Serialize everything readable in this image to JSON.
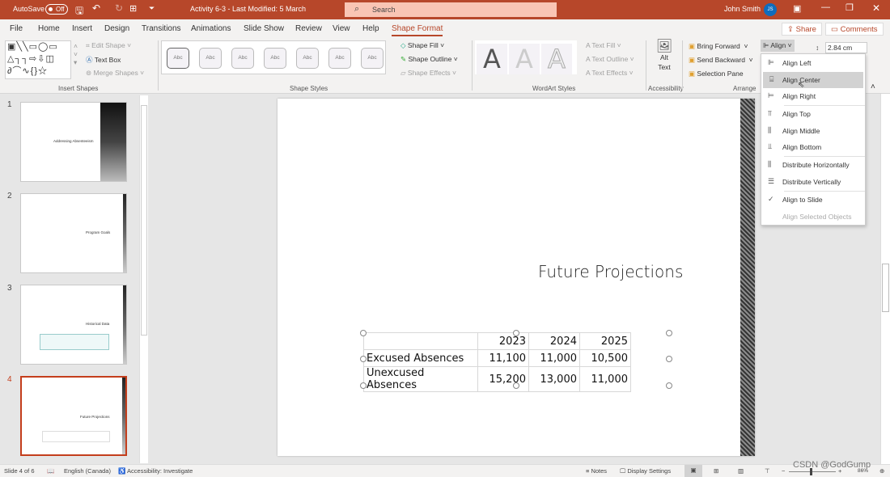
{
  "titlebar": {
    "autosave_label": "AutoSave",
    "autosave_state": "Off",
    "doc_title": "Activity 6-3  -  Last Modified: 5 March",
    "search_placeholder": "Search",
    "user_name": "John Smith",
    "user_initials": "JS"
  },
  "tabs": [
    {
      "label": "File"
    },
    {
      "label": "Home"
    },
    {
      "label": "Insert"
    },
    {
      "label": "Design"
    },
    {
      "label": "Transitions"
    },
    {
      "label": "Animations"
    },
    {
      "label": "Slide Show"
    },
    {
      "label": "Review"
    },
    {
      "label": "View"
    },
    {
      "label": "Help"
    },
    {
      "label": "Shape Format",
      "active": true
    }
  ],
  "share_label": "Share",
  "comments_label": "Comments",
  "ribbon": {
    "insert_shapes": {
      "label": "Insert Shapes",
      "edit_shape": "Edit Shape",
      "text_box": "Text Box",
      "merge_shapes": "Merge Shapes"
    },
    "shape_styles": {
      "label": "Shape Styles",
      "swatch": "Abc",
      "shape_fill": "Shape Fill",
      "shape_outline": "Shape Outline",
      "shape_effects": "Shape Effects"
    },
    "wordart": {
      "label": "WordArt Styles",
      "glyph": "A",
      "text_fill": "Text Fill",
      "text_outline": "Text Outline",
      "text_effects": "Text Effects"
    },
    "accessibility": {
      "label": "Accessibility",
      "alt_text": "Alt Text"
    },
    "arrange": {
      "label": "Arrange",
      "bring_forward": "Bring Forward",
      "send_backward": "Send Backward",
      "selection_pane": "Selection Pane",
      "align": "Align"
    },
    "size": {
      "height": "2.84 cm"
    }
  },
  "align_menu": [
    {
      "label": "Align Left",
      "icon": "align-left-icon"
    },
    {
      "label": "Align Center",
      "icon": "align-center-icon",
      "highlighted": true
    },
    {
      "label": "Align Right",
      "icon": "align-right-icon"
    },
    {
      "label": "Align Top",
      "icon": "align-top-icon"
    },
    {
      "label": "Align Middle",
      "icon": "align-middle-icon"
    },
    {
      "label": "Align Bottom",
      "icon": "align-bottom-icon"
    },
    {
      "label": "Distribute Horizontally",
      "icon": "distribute-horizontal-icon"
    },
    {
      "label": "Distribute Vertically",
      "icon": "distribute-vertical-icon"
    },
    {
      "label": "Align to Slide",
      "icon": "check-icon",
      "checked": true
    },
    {
      "label": "Align Selected Objects",
      "disabled": true
    }
  ],
  "thumbnails": [
    {
      "num": "1",
      "title": "Addressing Absenteeism"
    },
    {
      "num": "2",
      "title": "Program Goals"
    },
    {
      "num": "3",
      "title": "Historical Data"
    },
    {
      "num": "4",
      "title": "Future Projections",
      "selected": true
    }
  ],
  "slide": {
    "title": "Future Projections",
    "table": {
      "headers": [
        "",
        "2023",
        "2024",
        "2025"
      ],
      "rows": [
        [
          "Excused Absences",
          "11,100",
          "11,000",
          "10,500"
        ],
        [
          "Unexcused Absences",
          "15,200",
          "13,000",
          "11,000"
        ]
      ]
    }
  },
  "status": {
    "slide_info": "Slide 4 of 6",
    "language": "English (Canada)",
    "accessibility": "Accessibility: Investigate",
    "notes": "Notes",
    "display_settings": "Display Settings",
    "zoom": "86%"
  },
  "watermark": "CSDN @GodGump",
  "colors": {
    "accent": "#b7472a",
    "selected_thumb": "#c43e1c",
    "avatar": "#0f6cbd"
  }
}
